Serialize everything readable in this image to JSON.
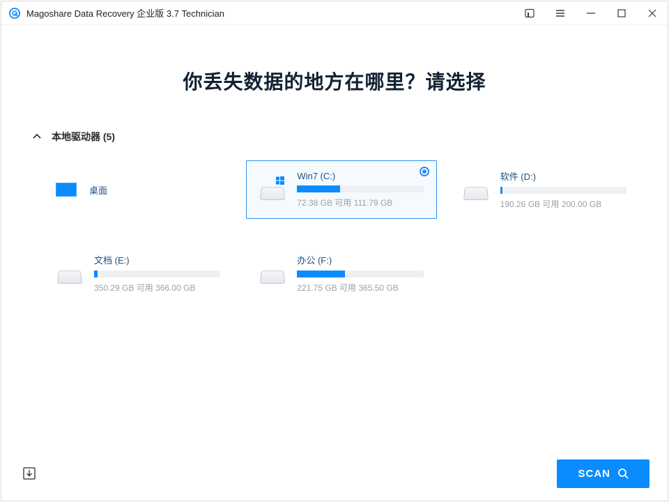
{
  "title": "Magoshare Data Recovery 企业版 3.7 Technician",
  "headline": "你丢失数据的地方在哪里？请选择",
  "section": {
    "title": "本地驱动器 (5)"
  },
  "desktop": {
    "label": "桌面"
  },
  "drives": [
    {
      "name": "Win7 (C:)",
      "used_pct": 34,
      "sub": "72.38 GB 可用 111.79 GB",
      "selected": true,
      "os": true
    },
    {
      "name": "软件 (D:)",
      "used_pct": 2,
      "sub": "190.26 GB 可用 200.00 GB",
      "selected": false,
      "os": false
    },
    {
      "name": "文档 (E:)",
      "used_pct": 3,
      "sub": "350.29 GB 可用 366.00 GB",
      "selected": false,
      "os": false
    },
    {
      "name": "办公 (F:)",
      "used_pct": 38,
      "sub": "221.75 GB 可用 365.50 GB",
      "selected": false,
      "os": false
    }
  ],
  "scan_label": "SCAN"
}
